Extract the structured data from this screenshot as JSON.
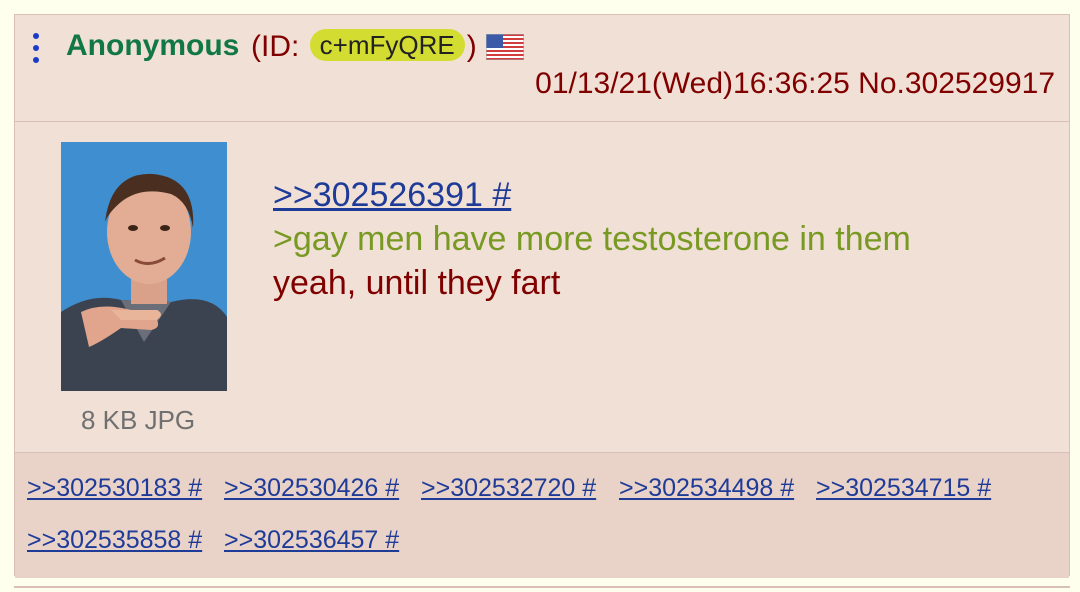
{
  "post": {
    "name": "Anonymous",
    "id_prefix": "(ID: ",
    "id_value": "c+mFyQRE",
    "id_suffix": ")",
    "flag": "flag-us-icon",
    "datetime": "01/13/21(Wed)16:36:25 No.302529917",
    "file_info": "8 KB JPG",
    "body": {
      "quote_link": ">>302526391 #",
      "greentext": ">gay men have more testosterone in them",
      "text": "yeah, until they fart"
    }
  },
  "replies": [
    ">>302530183 #",
    ">>302530426 #",
    ">>302532720 #",
    ">>302534498 #",
    ">>302534715 #",
    ">>302535858 #",
    ">>302536457 #"
  ],
  "colors": {
    "background": "#f0e0d6",
    "name": "#117743",
    "link": "#1f3b98",
    "greentext": "#789922",
    "text": "#800000"
  }
}
